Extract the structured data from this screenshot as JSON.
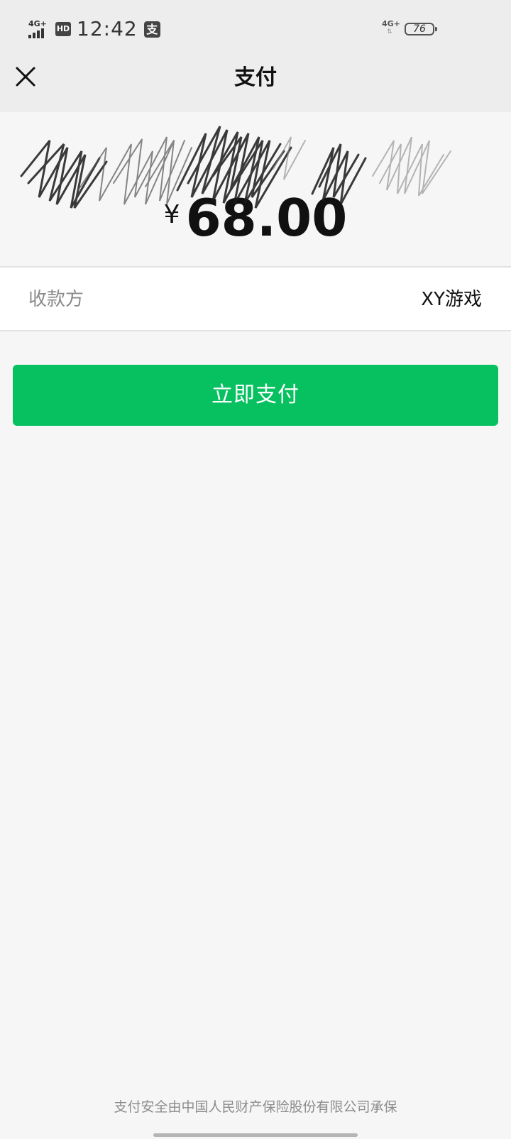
{
  "status_bar": {
    "network_left": "4G+",
    "hd_label": "HD",
    "time": "12:42",
    "alipay_glyph": "支",
    "network_right": "4G+",
    "battery_level": "76",
    "signal_icon": "signal-bars-icon",
    "battery_icon": "battery-icon"
  },
  "nav": {
    "close_icon": "close-icon",
    "title": "支付"
  },
  "payment": {
    "currency_symbol": "¥",
    "amount": "68.00",
    "payee_label": "收款方",
    "payee_name": "XY游戏"
  },
  "actions": {
    "pay_button_label": "立即支付"
  },
  "footer": {
    "insurance_text": "支付安全由中国人民财产保险股份有限公司承保"
  },
  "colors": {
    "header_background": "#ededed",
    "page_background": "#f6f6f6",
    "primary_green": "#07c160",
    "text_primary": "#111111",
    "text_secondary": "#8a8a8a"
  }
}
